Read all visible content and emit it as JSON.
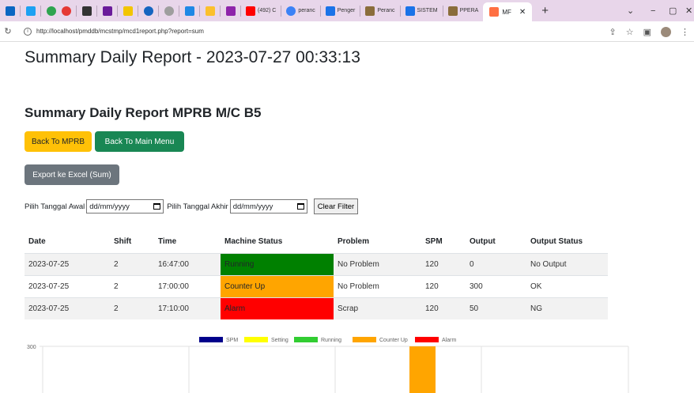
{
  "browser": {
    "tabs": [
      {
        "label": "(492) C",
        "icon": "youtube-icon",
        "color": "#ff0000"
      },
      {
        "label": "peranc",
        "icon": "web-icon",
        "color": "#3b82f6"
      },
      {
        "label": "Penger",
        "icon": "doc-icon",
        "color": "#1a73e8"
      },
      {
        "label": "Peranc",
        "icon": "pdf-icon",
        "color": "#8a6d3b"
      },
      {
        "label": "SISTEM",
        "icon": "doc-icon",
        "color": "#1a73e8"
      },
      {
        "label": "PPERA",
        "icon": "pdf-icon",
        "color": "#8a6d3b"
      }
    ],
    "active_tab": "MF",
    "url": "http://localhost/pmddb/mcstmp/mcd1report.php?report=sum"
  },
  "page": {
    "title": "Summary Daily Report - 2023-07-27 00:33:13",
    "subtitle": "Summary Daily Report MPRB M/C B5",
    "btn_back_mprb": "Back To MPRB",
    "btn_back_main": "Back To Main Menu",
    "btn_export": "Export ke Excel (Sum)",
    "filter": {
      "start_label": "Pilih Tanggal Awal",
      "start_placeholder": "dd/mm/yyyy",
      "end_label": "Pilih Tanggal Akhir",
      "end_placeholder": "dd/mm/yyyy",
      "clear_label": "Clear Filter"
    }
  },
  "table": {
    "headers": [
      "Date",
      "Shift",
      "Time",
      "Machine Status",
      "Problem",
      "SPM",
      "Output",
      "Output Status"
    ],
    "rows": [
      {
        "date": "2023-07-25",
        "shift": "2",
        "time": "16:47:00",
        "status": "Running",
        "status_color": "#008000",
        "problem": "No Problem",
        "spm": "120",
        "output": "0",
        "output_status": "No Output"
      },
      {
        "date": "2023-07-25",
        "shift": "2",
        "time": "17:00:00",
        "status": "Counter Up",
        "status_color": "#ffa500",
        "problem": "No Problem",
        "spm": "120",
        "output": "300",
        "output_status": "OK"
      },
      {
        "date": "2023-07-25",
        "shift": "2",
        "time": "17:10:00",
        "status": "Alarm",
        "status_color": "#ff0000",
        "problem": "Scrap",
        "spm": "120",
        "output": "50",
        "output_status": "NG"
      }
    ]
  },
  "chart_data": {
    "type": "bar",
    "legend": [
      {
        "name": "SPM",
        "color": "#00008b"
      },
      {
        "name": "Setting",
        "color": "#ffff00"
      },
      {
        "name": "Running",
        "color": "#32cd32"
      },
      {
        "name": "Counter Up",
        "color": "#ffa500"
      },
      {
        "name": "Alarm",
        "color": "#ff0000"
      }
    ],
    "y_ticks": [
      "300"
    ],
    "ylim": [
      0,
      300
    ],
    "series": [
      {
        "name": "Counter Up",
        "color": "#ffa500",
        "values": [
          300
        ]
      }
    ],
    "grid": true,
    "legend_position": "top"
  }
}
